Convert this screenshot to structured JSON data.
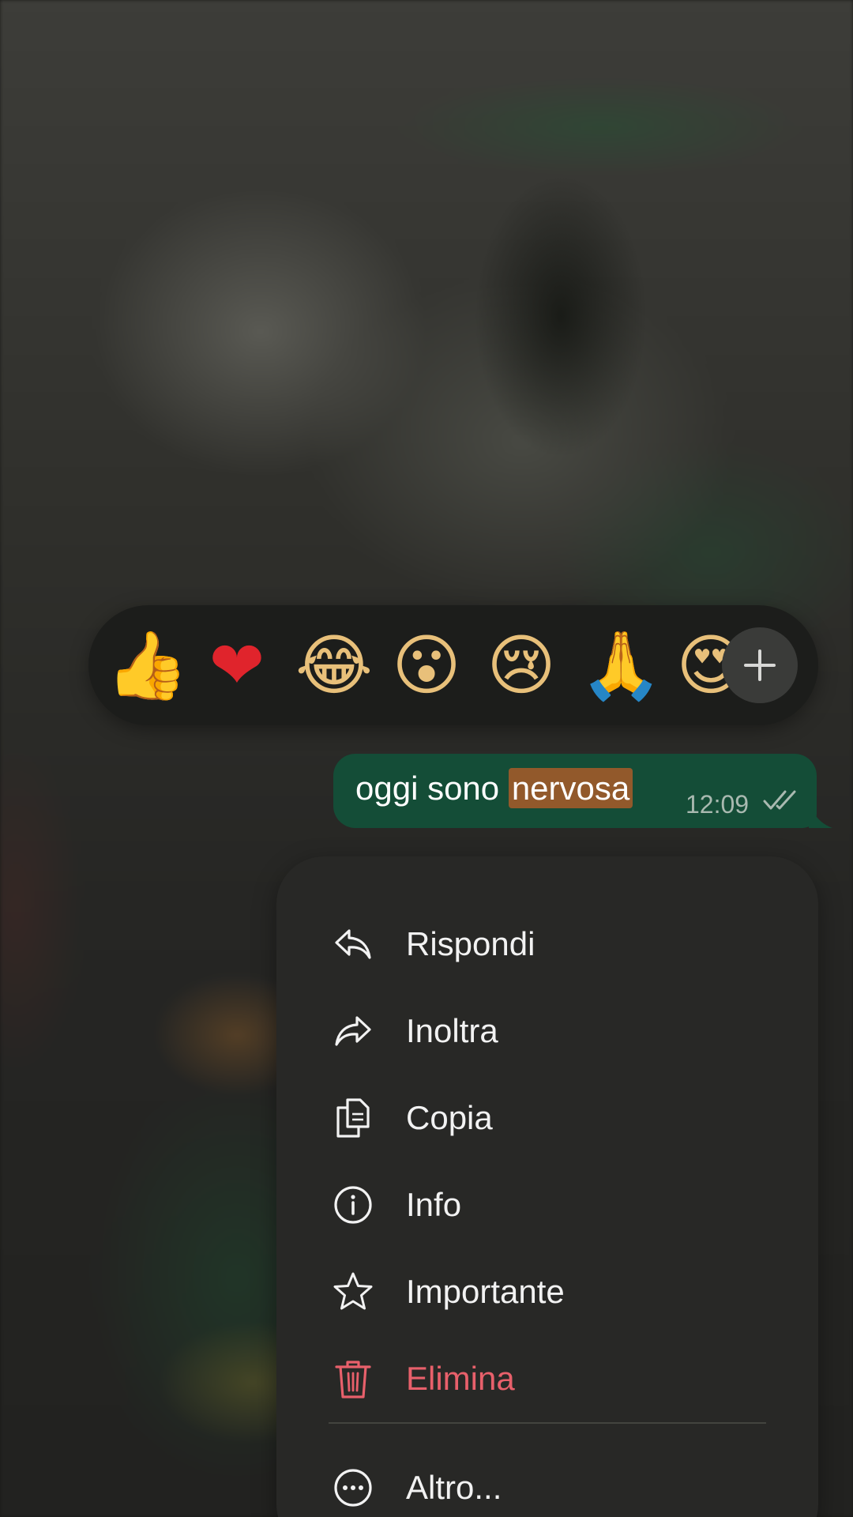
{
  "reactions": {
    "emojis": [
      {
        "name": "thumbs-up",
        "glyph": "👍"
      },
      {
        "name": "red-heart",
        "glyph": "❤"
      },
      {
        "name": "tears-of-joy",
        "glyph": "😂"
      },
      {
        "name": "astonished",
        "glyph": "😮"
      },
      {
        "name": "crying",
        "glyph": "😢"
      },
      {
        "name": "folded-hands",
        "glyph": "🙏"
      },
      {
        "name": "heart-eyes",
        "glyph": "😍"
      }
    ],
    "more_icon": "plus-icon"
  },
  "message": {
    "text_before": "oggi sono ",
    "highlighted_text": "nervosa",
    "time": "12:09",
    "status_icon": "double-check-icon",
    "bubble_color": "#144d37",
    "highlight_color": "#92592b"
  },
  "menu": {
    "items": [
      {
        "label": "Rispondi",
        "icon": "reply-icon"
      },
      {
        "label": "Inoltra",
        "icon": "forward-icon"
      },
      {
        "label": "Copia",
        "icon": "copy-icon"
      },
      {
        "label": "Info",
        "icon": "info-icon"
      },
      {
        "label": "Importante",
        "icon": "star-icon"
      },
      {
        "label": "Elimina",
        "icon": "trash-icon",
        "color": "#e8606b"
      },
      {
        "label": "Altro...",
        "icon": "more-icon"
      }
    ]
  }
}
